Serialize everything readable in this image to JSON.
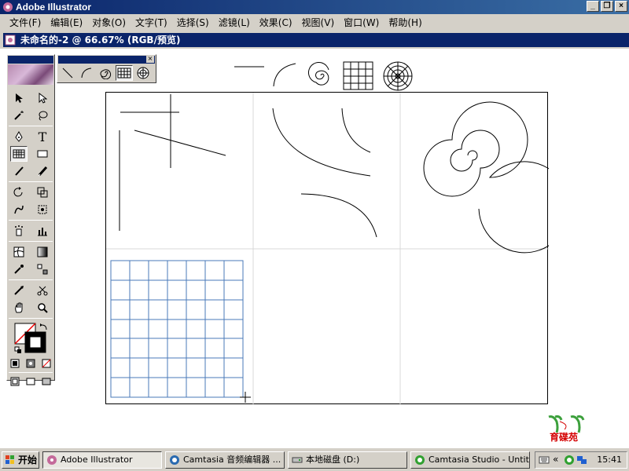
{
  "window": {
    "title": "Adobe Illustrator",
    "controls": [
      "_",
      "❐",
      "×"
    ]
  },
  "menu": [
    "文件(F)",
    "编辑(E)",
    "对象(O)",
    "文字(T)",
    "选择(S)",
    "滤镜(L)",
    "效果(C)",
    "视图(V)",
    "窗口(W)",
    "帮助(H)"
  ],
  "document": {
    "title": "未命名的-2 @ 66.67% (RGB/预览)"
  },
  "toolbox": {
    "tools": [
      "selection-tool",
      "direct-selection-tool",
      "magic-wand-tool",
      "lasso-tool",
      "pen-tool",
      "type-tool",
      "rectangular-grid-tool",
      "rectangle-tool",
      "paintbrush-tool",
      "pencil-tool",
      "rotate-tool",
      "scale-tool",
      "warp-tool",
      "free-transform-tool",
      "symbol-sprayer-tool",
      "column-graph-tool",
      "mesh-tool",
      "gradient-tool",
      "eyedropper-tool",
      "blend-tool",
      "slice-tool",
      "scissors-tool",
      "hand-tool",
      "zoom-tool"
    ],
    "type_glyph": "T"
  },
  "sub_palette": {
    "tools": [
      "line-segment-tool",
      "arc-tool",
      "spiral-tool",
      "rectangular-grid-tool",
      "polar-grid-tool"
    ],
    "close": "×"
  },
  "taskbar": {
    "start": "开始",
    "items": [
      {
        "label": "Adobe Illustrator",
        "active": true
      },
      {
        "label": "Camtasia 音频编辑器 ...",
        "active": false
      },
      {
        "label": "本地磁盘 (D:)",
        "active": false
      },
      {
        "label": "Camtasia Studio - Untitl...",
        "active": false
      }
    ],
    "tray_chevron": "«",
    "clock": "15:41"
  },
  "logo": {
    "text": "育碟苑"
  },
  "colors": {
    "grid": "#4a7ab8",
    "titlebar": "#0a246a",
    "chrome": "#d4d0c8"
  }
}
